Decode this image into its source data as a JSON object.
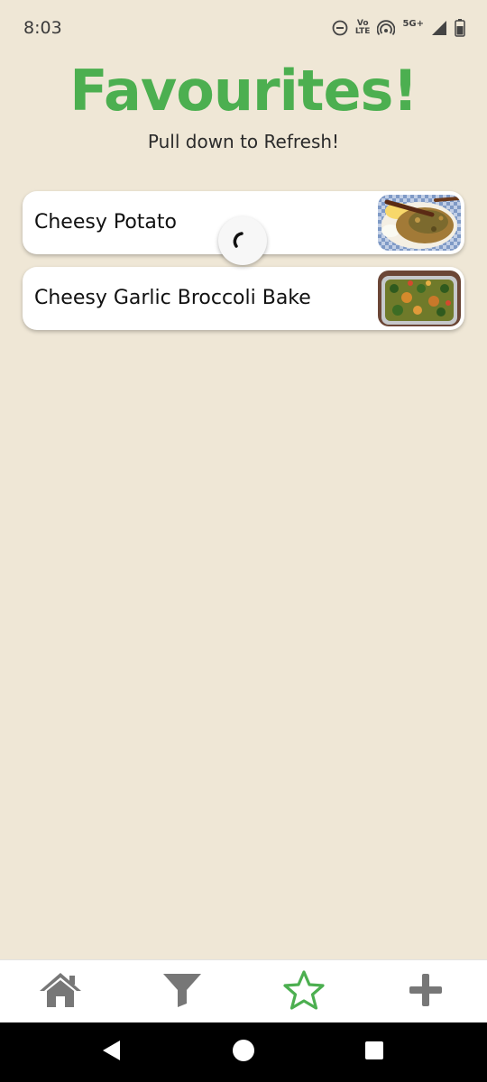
{
  "status_bar": {
    "time": "8:03",
    "volte_top": "Vo",
    "volte_bottom": "LTE",
    "network": "5G+",
    "icons": [
      "do-not-disturb-icon",
      "volte-icon",
      "hotspot-icon",
      "signal-icon",
      "battery-icon"
    ]
  },
  "header": {
    "title": "Favourites!",
    "subtitle": "Pull down to Refresh!",
    "title_color": "#4caf50"
  },
  "favourites": [
    {
      "name": "Cheesy Potato"
    },
    {
      "name": "Cheesy Garlic Broccoli Bake"
    }
  ],
  "bottom_nav": {
    "items": [
      "home-icon",
      "filter-icon",
      "star-icon",
      "plus-icon"
    ],
    "active": "star-icon",
    "active_color": "#4caf50",
    "inactive_color": "#777777"
  },
  "colors": {
    "background": "#efe7d6"
  }
}
